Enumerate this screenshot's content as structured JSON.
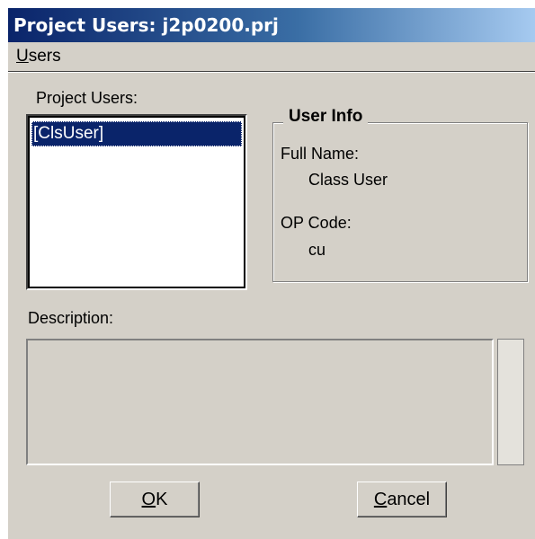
{
  "window": {
    "title": "Project Users: j2p0200.prj"
  },
  "menu": {
    "users_label": "Users",
    "users_underline": "U",
    "users_rest": "sers"
  },
  "project_users": {
    "label": "Project Users:",
    "items": [
      "[ClsUser]"
    ],
    "selected_index": 0
  },
  "user_info": {
    "title": "User Info",
    "full_name_label": "Full Name:",
    "full_name_value": "Class User",
    "op_code_label": "OP Code:",
    "op_code_value": "cu"
  },
  "description": {
    "label": "Description:",
    "value": ""
  },
  "buttons": {
    "ok_label": "OK",
    "ok_underline": "O",
    "ok_rest": "K",
    "cancel_label": "Cancel",
    "cancel_underline": "C",
    "cancel_rest": "ancel"
  },
  "colors": {
    "title_bar_start": "#0a246a",
    "title_bar_end": "#a6caf0",
    "dialog_face": "#d4d0c8",
    "selection": "#0a246a"
  }
}
